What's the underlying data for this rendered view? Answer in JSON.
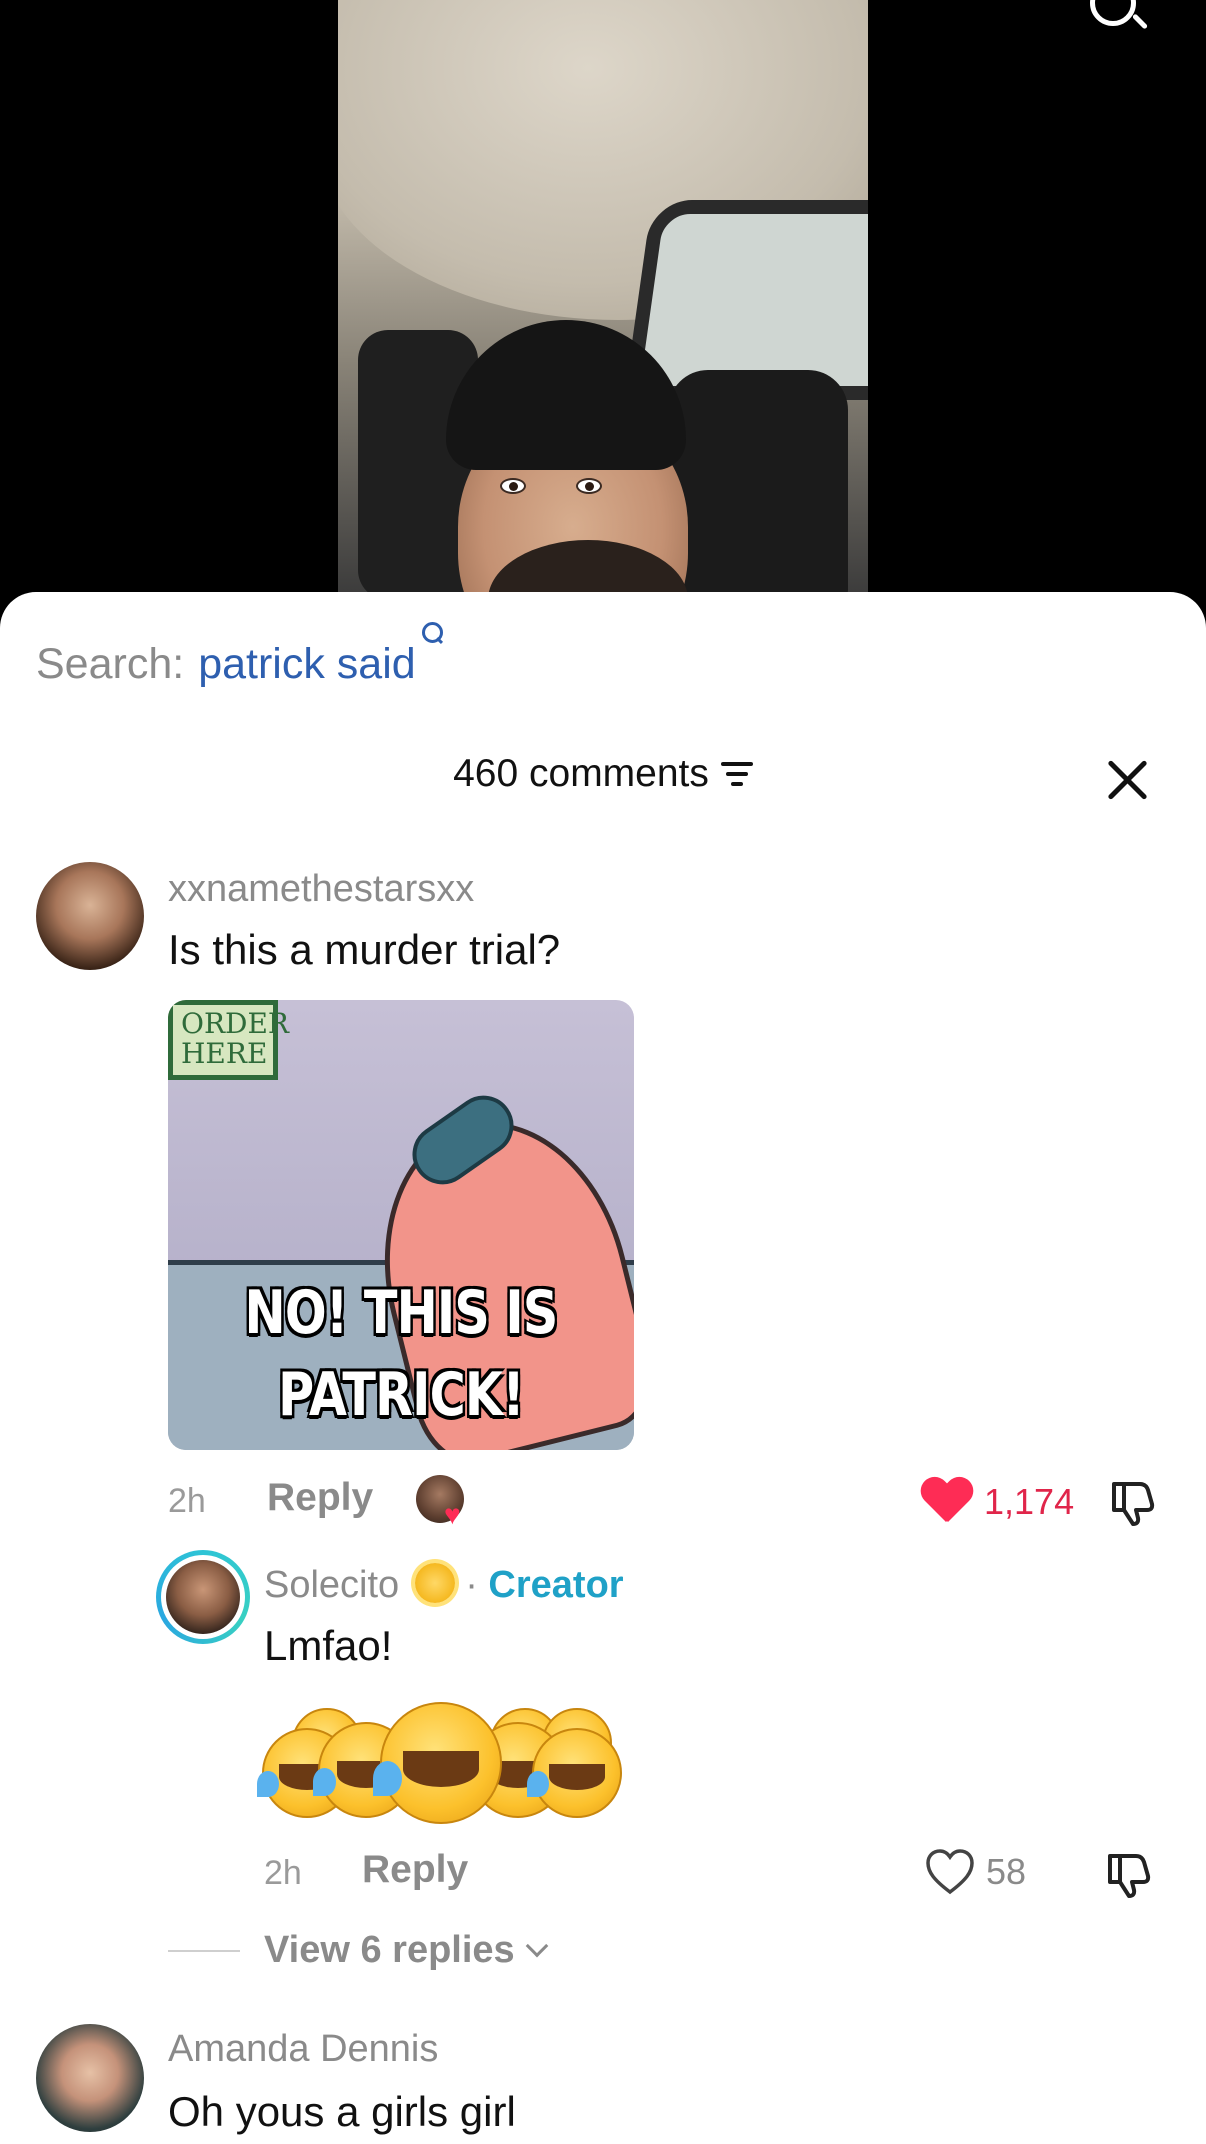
{
  "search": {
    "prefix": "Search:",
    "query": "patrick said"
  },
  "comments_header": {
    "count_label": "460 comments"
  },
  "comments": [
    {
      "username": "xxnamethestarsxx",
      "text": "Is this a murder trial?",
      "meme_caption_line1": "NO! THIS IS",
      "meme_caption_line2": "PATRICK!",
      "meme_sign": "ORDER HERE",
      "time": "2h",
      "reply_label": "Reply",
      "likes": "1,174",
      "liked": true
    },
    {
      "username": "Solecito",
      "creator_label": "Creator",
      "separator": "·",
      "text": "Lmfao!",
      "time": "2h",
      "reply_label": "Reply",
      "likes": "58",
      "liked": false
    },
    {
      "username": "Amanda Dennis",
      "text": "Oh yous a girls girl"
    }
  ],
  "view_replies": {
    "label": "View 6 replies"
  },
  "colors": {
    "accent_red": "#fe2c55",
    "search_blue": "#2e5faf",
    "creator_teal": "#1fa1c7"
  },
  "icons": [
    "search-icon",
    "filter-icon",
    "close-icon",
    "heart-icon",
    "dislike-icon",
    "chevron-down-icon"
  ]
}
